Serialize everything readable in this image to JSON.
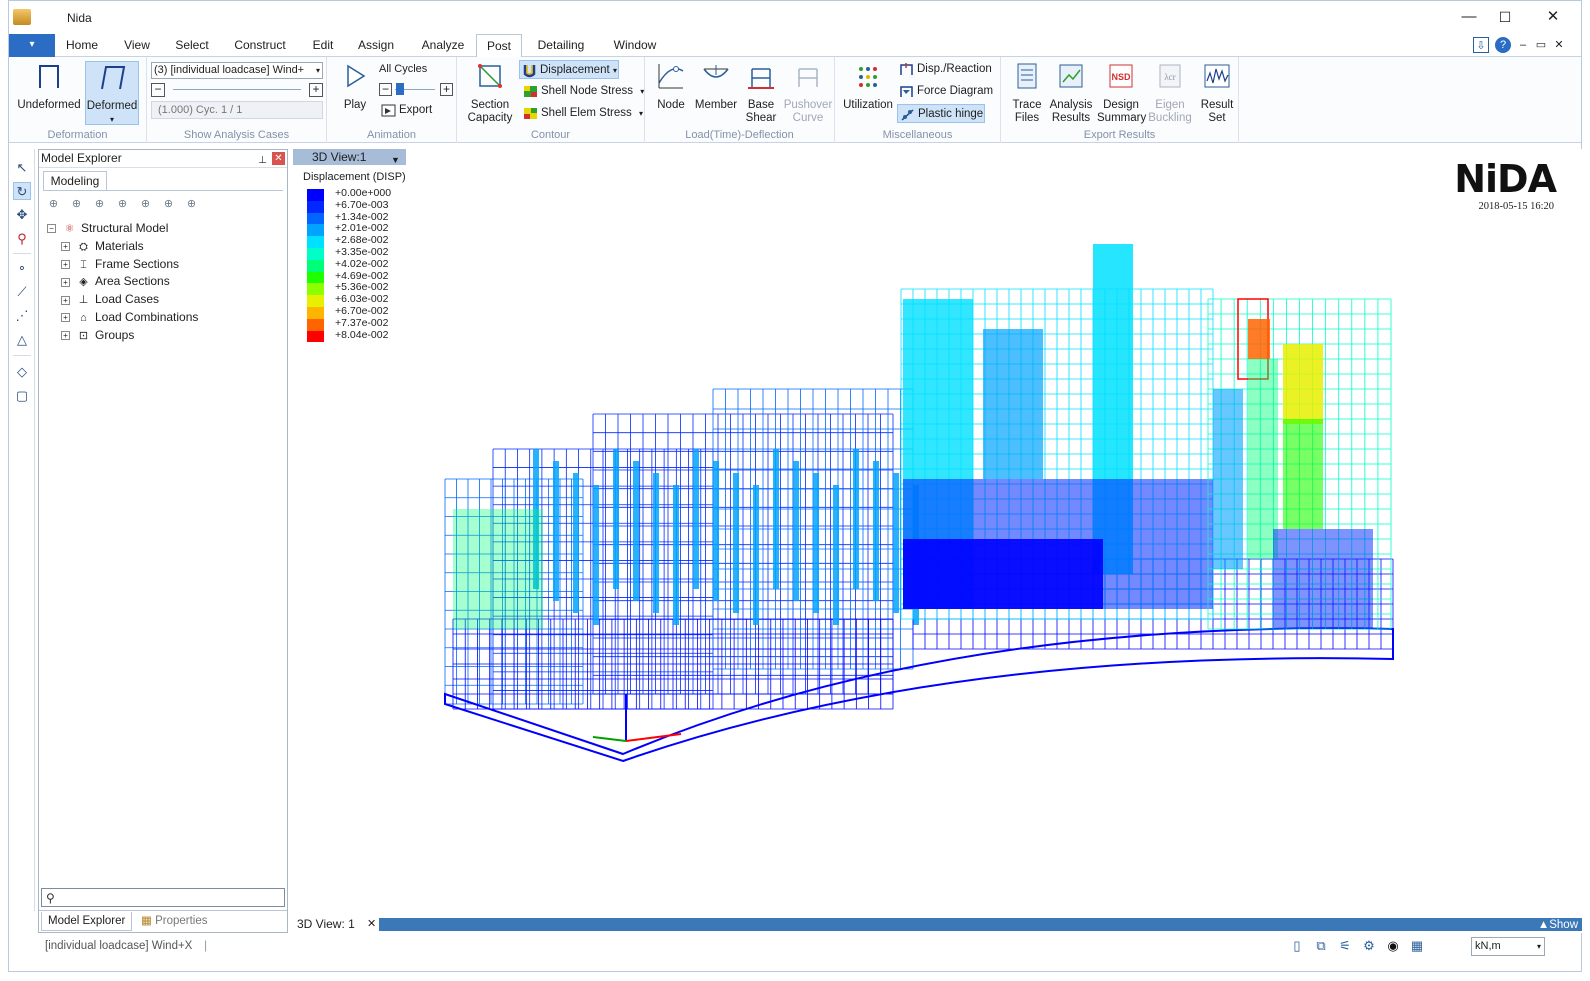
{
  "window": {
    "title": "Nida",
    "minimize": "—",
    "maximize": "☐",
    "close": "✕"
  },
  "ribbon_tabs": [
    "Home",
    "View",
    "Select",
    "Construct",
    "Edit",
    "Assign",
    "Analyze",
    "Post",
    "Detailing",
    "Window"
  ],
  "active_tab": "Post",
  "quick_access": {
    "file_arrow": "▾",
    "icons": [
      "export-icon",
      "help-icon"
    ],
    "mdi": [
      "–",
      "▭",
      "✕"
    ]
  },
  "groups": {
    "deformation": {
      "label": "Deformation",
      "undeformed": "Undeformed",
      "deformed": "Deformed",
      "deformed_arrow": "▾"
    },
    "analysis_cases": {
      "label": "Show Analysis Cases",
      "case_value": "(3) [individual loadcase] Wind+",
      "cycle_text": "(1.000) Cyc. 1 / 1",
      "minus": "−",
      "plus": "+"
    },
    "animation": {
      "label": "Animation",
      "play": "Play",
      "all_cycles": "All Cycles",
      "export": "Export",
      "minus": "−",
      "plus": "+"
    },
    "contour": {
      "label": "Contour",
      "section_capacity": "Section Capacity",
      "displacement": "Displacement",
      "shell_node_stress": "Shell Node Stress",
      "shell_elem_stress": "Shell Elem Stress"
    },
    "load_time": {
      "label": "Load(Time)-Deflection",
      "node": "Node",
      "member": "Member",
      "base_shear": "Base Shear",
      "pushover": "Pushover Curve"
    },
    "misc": {
      "label": "Miscellaneous",
      "utilization": "Utilization",
      "disp_reaction": "Disp./Reaction",
      "force_diagram": "Force Diagram",
      "plastic_hinge": "Plastic hinge"
    },
    "export": {
      "label": "Export Results",
      "trace": "Trace Files",
      "analysis": "Analysis Results",
      "design": "Design Summary",
      "eigen": "Eigen Buckling",
      "result_set": "Result Set"
    }
  },
  "explorer": {
    "title": "Model Explorer",
    "pin": "📌",
    "close": "✕",
    "subtab": "Modeling",
    "tree_root": "Structural Model",
    "tree_items": [
      "Materials",
      "Frame Sections",
      "Area Sections",
      "Load Cases",
      "Load Combinations",
      "Groups"
    ],
    "search_placeholder": "",
    "bottom_tabs": [
      "Model Explorer",
      "Properties"
    ]
  },
  "viewport": {
    "tab_label": "3D View:1",
    "legend_title": "Displacement (DISP)",
    "legend": [
      {
        "value": "+0.00e+000",
        "color": "#0000ff"
      },
      {
        "value": "+6.70e-003",
        "color": "#0028ff"
      },
      {
        "value": "+1.34e-002",
        "color": "#0066ff"
      },
      {
        "value": "+2.01e-002",
        "color": "#00a4ff"
      },
      {
        "value": "+2.68e-002",
        "color": "#00e0ff"
      },
      {
        "value": "+3.35e-002",
        "color": "#00ffc8"
      },
      {
        "value": "+4.02e-002",
        "color": "#00ff78"
      },
      {
        "value": "+4.69e-002",
        "color": "#1eff00"
      },
      {
        "value": "+5.36e-002",
        "color": "#8cff00"
      },
      {
        "value": "+6.03e-002",
        "color": "#e6f000"
      },
      {
        "value": "+6.70e-002",
        "color": "#ffb400"
      },
      {
        "value": "+7.37e-002",
        "color": "#ff6400"
      },
      {
        "value": "+8.04e-002",
        "color": "#ff0000"
      }
    ],
    "logo": "NiDA",
    "datetime": "2018-05-15 16:20"
  },
  "doc_tabs": {
    "tab": "3D View: 1",
    "close": "✕",
    "show": "▲Show"
  },
  "status": {
    "text": "[individual loadcase] Wind+X",
    "unit": "kN,m"
  },
  "colors": {
    "accent": "#2b6cc4",
    "selection": "#cfe3f8",
    "group_label": "#8292a8",
    "frame_blue": "#0000ff",
    "peak_red": "#ff0000"
  }
}
